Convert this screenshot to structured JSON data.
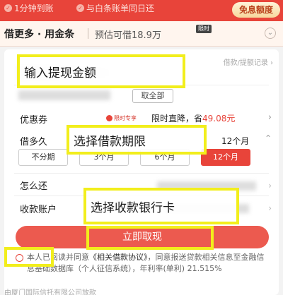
{
  "topbar": {
    "feature_1": "1分钟到账",
    "feature_2": "与白条账单同日还",
    "quota_button": "免息额度"
  },
  "product": {
    "name": "借更多 · 用金条",
    "estimate": "预估可借18.9万",
    "badge": "限时"
  },
  "withdraw": {
    "records_link": "借款/提额记录 ›",
    "all_button": "取全部"
  },
  "coupon": {
    "label": "优惠券",
    "tag": "限时专享",
    "text_prefix": "限时直降，省",
    "amount": "49.08元"
  },
  "term": {
    "label": "借多久",
    "value": "12个月",
    "options": [
      "不分期",
      "3个月",
      "6个月",
      "12个月"
    ],
    "selected_index": 3
  },
  "repay": {
    "label": "怎么还"
  },
  "account": {
    "label": "收款账户"
  },
  "submit_label": "立即取现",
  "agreement": {
    "prefix": "本人已阅读并同意",
    "link": "《相关借款协议》",
    "rest": "，同意报送贷款相关信息至金融信息基础数据库（个人征信系统），年利率(单利) 21.515%"
  },
  "footer": "由厦门国际信托有限公司放款",
  "annotations": {
    "amount": "输入提现金额",
    "term": "选择借款期限",
    "bank": "选择收款银行卡"
  },
  "colors": {
    "accent": "#e8443a",
    "highlight": "#f2ee1c"
  }
}
